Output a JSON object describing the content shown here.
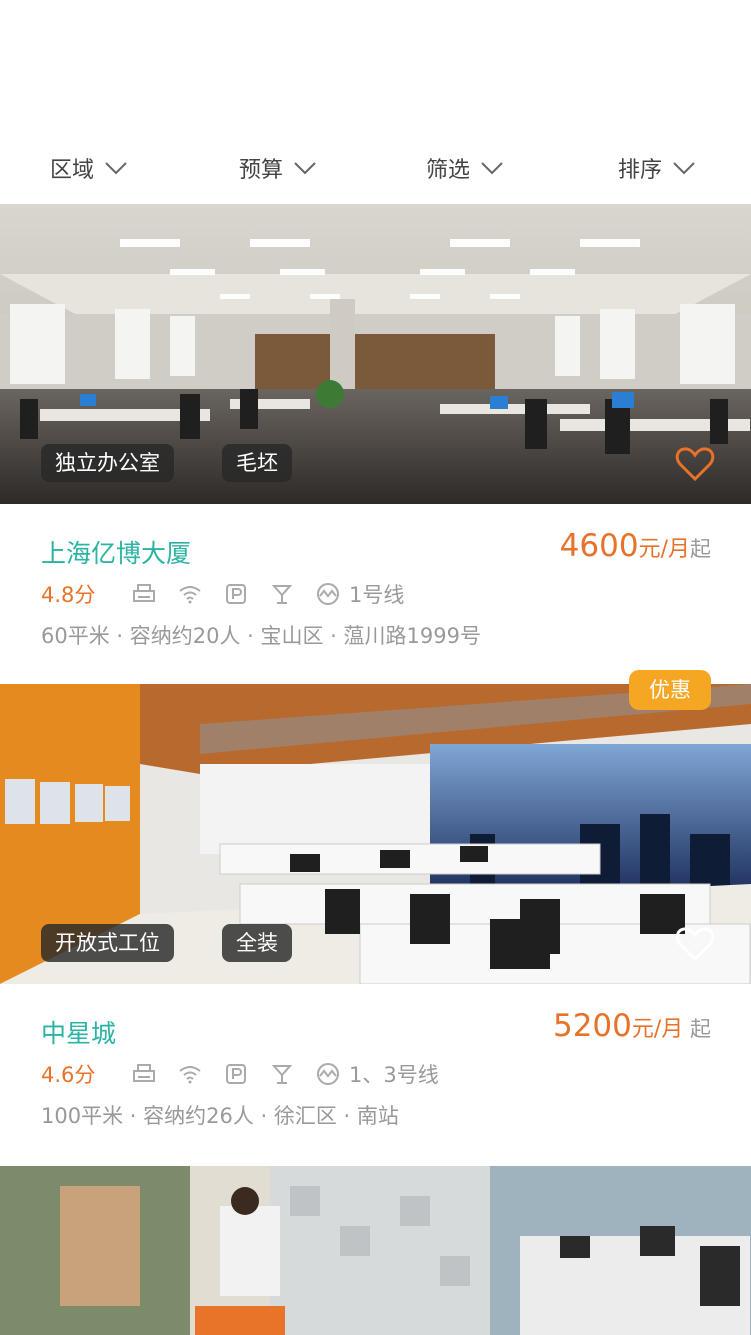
{
  "filters": [
    {
      "label": "区域"
    },
    {
      "label": "预算"
    },
    {
      "label": "筛选"
    },
    {
      "label": "排序"
    }
  ],
  "listings": [
    {
      "tags": [
        "独立办公室",
        "毛坯"
      ],
      "name": "上海亿博大厦",
      "price": "4600",
      "price_unit": "元/月",
      "price_suffix": "起",
      "score": "4.8分",
      "metro": "1号线",
      "address": "60平米 · 容纳约20人 · 宝山区 · 蕰川路1999号",
      "favorite_active": true,
      "promo": ""
    },
    {
      "tags": [
        "开放式工位",
        "全装"
      ],
      "name": "中星城",
      "price": "5200",
      "price_unit": "元/月",
      "price_suffix": " 起",
      "score": "4.6分",
      "metro": "1、3号线",
      "address": "100平米 · 容纳约26人 · 徐汇区 · 南站",
      "favorite_active": false,
      "promo": "优惠"
    }
  ],
  "colors": {
    "accent_teal": "#2bb3a3",
    "accent_orange": "#e8722a",
    "promo_yellow": "#f5a623",
    "muted_text": "#999999"
  },
  "icons": [
    "chevron-down-icon",
    "printer-icon",
    "wifi-icon",
    "parking-icon",
    "cocktail-icon",
    "metro-icon",
    "heart-icon"
  ]
}
